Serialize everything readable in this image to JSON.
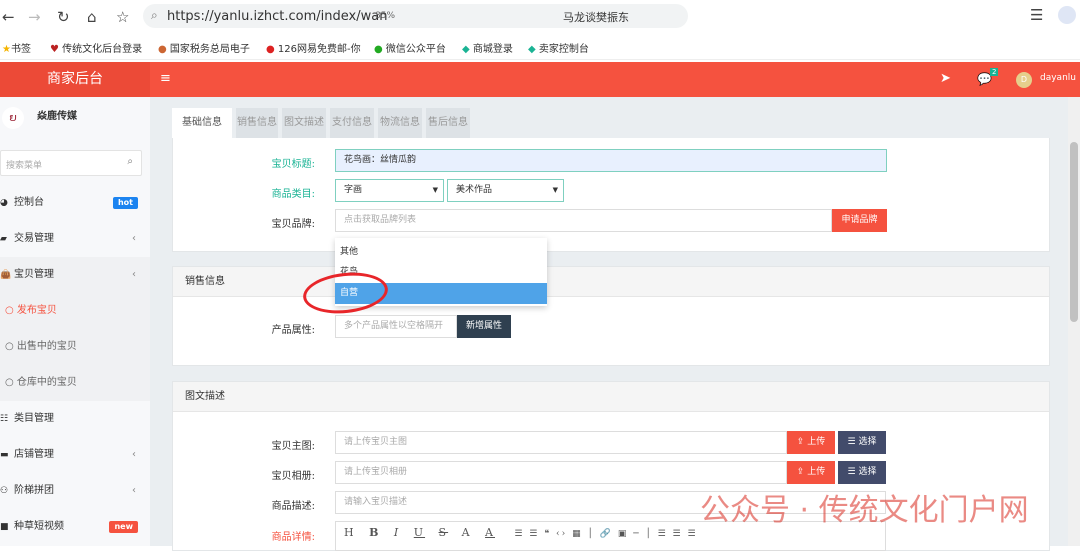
{
  "browser": {
    "url": "https://yanlu.izhct.com/index/wan",
    "zoom": "85%",
    "search_engine_text": "马龙谈樊振东"
  },
  "bookmarks": [
    "书签",
    "传统文化后台登录",
    "国家税务总局电子",
    "126网易免费邮-你",
    "微信公众平台",
    "商城登录",
    "卖家控制台"
  ],
  "header": {
    "logo": "商家后台",
    "menu_icon": "≡",
    "message_count": "2",
    "avatar_letter": "D",
    "username": "dayanlu"
  },
  "sidebar": {
    "brand": "焱鹿传媒",
    "search_placeholder": "搜索菜单",
    "items": [
      {
        "label": "控制台",
        "badge": "hot"
      },
      {
        "label": "交易管理"
      },
      {
        "label": "宝贝管理"
      },
      {
        "label": "发布宝贝",
        "active": true
      },
      {
        "label": "出售中的宝贝"
      },
      {
        "label": "仓库中的宝贝"
      },
      {
        "label": "类目管理"
      },
      {
        "label": "店铺管理"
      },
      {
        "label": "阶梯拼团"
      },
      {
        "label": "种草短视频",
        "badge": "new"
      }
    ]
  },
  "tabs": [
    "基础信息",
    "销售信息",
    "图文描述",
    "支付信息",
    "物流信息",
    "售后信息"
  ],
  "basic": {
    "title_label": "宝贝标题:",
    "title_value": "花鸟画：丝情瓜韵",
    "category_label": "商品类目:",
    "category1": "字画",
    "category2": "美术作品",
    "brand_label": "宝贝品牌:",
    "brand_placeholder": "点击获取品牌列表",
    "apply_brand": "申请品牌",
    "dropdown": [
      "其他",
      "花鸟",
      "自营"
    ],
    "selected": "自营"
  },
  "sales": {
    "header": "销售信息",
    "attr_label": "产品属性:",
    "attr_placeholder": "多个产品属性以空格隔开",
    "add_attr": "新增属性"
  },
  "desc": {
    "header": "图文描述",
    "main_img_label": "宝贝主图:",
    "main_img_placeholder": "请上传宝贝主图",
    "album_label": "宝贝相册:",
    "album_placeholder": "请上传宝贝相册",
    "desc_label": "商品描述:",
    "desc_placeholder": "请输入宝贝描述",
    "detail_label": "商品详情:",
    "upload": "上传",
    "choose": "选择",
    "toolbar": [
      "H",
      "B",
      "I",
      "U",
      "S",
      "A",
      "A"
    ]
  },
  "watermark": "公众号 · 传统文化门户网",
  "colors": {
    "brand": "#f5523f",
    "teal": "#1ab394",
    "selected": "#4fa3e8",
    "dark": "#2f4050"
  }
}
